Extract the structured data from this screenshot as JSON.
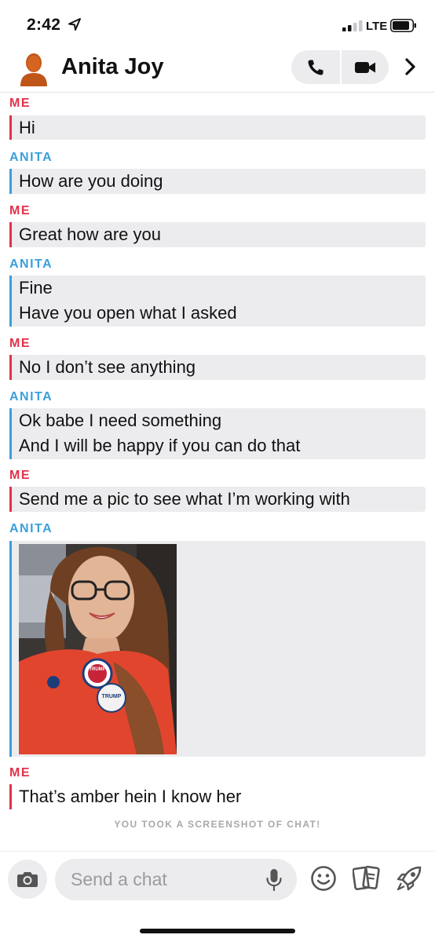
{
  "status_bar": {
    "time": "2:42",
    "network": "LTE"
  },
  "header": {
    "contact_name": "Anita Joy"
  },
  "chat": {
    "messages": [
      {
        "sender": "ME",
        "lines": [
          "Hi"
        ]
      },
      {
        "sender": "ANITA",
        "lines": [
          "How are you doing"
        ]
      },
      {
        "sender": "ME",
        "lines": [
          "Great how are you"
        ]
      },
      {
        "sender": "ANITA",
        "lines": [
          "Fine",
          "Have you open what I asked"
        ]
      },
      {
        "sender": "ME",
        "lines": [
          "No I don’t see anything"
        ]
      },
      {
        "sender": "ANITA",
        "lines": [
          "Ok babe I need something",
          "And I will be happy if you can do that"
        ]
      },
      {
        "sender": "ME",
        "lines": [
          "Send me a pic to see what I’m working with"
        ]
      },
      {
        "sender": "ANITA",
        "photo": {
          "badge_top": "TRUMP",
          "badge_bottom": "TRUMP"
        }
      },
      {
        "sender": "ME",
        "lines": [
          "That’s amber hein I know her"
        ]
      }
    ],
    "screenshot_notice": "YOU TOOK A SCREENSHOT OF CHAT!"
  },
  "composer": {
    "placeholder": "Send a chat"
  },
  "colors": {
    "me": "#e1324a",
    "anita": "#3b9fdc",
    "bubble": "#ececef"
  },
  "icons": [
    "location-arrow-icon",
    "signal-icon",
    "battery-icon",
    "avatar-icon",
    "phone-icon",
    "video-icon",
    "chevron-right-icon",
    "camera-icon",
    "mic-icon",
    "emoji-icon",
    "cards-icon",
    "rocket-icon"
  ]
}
